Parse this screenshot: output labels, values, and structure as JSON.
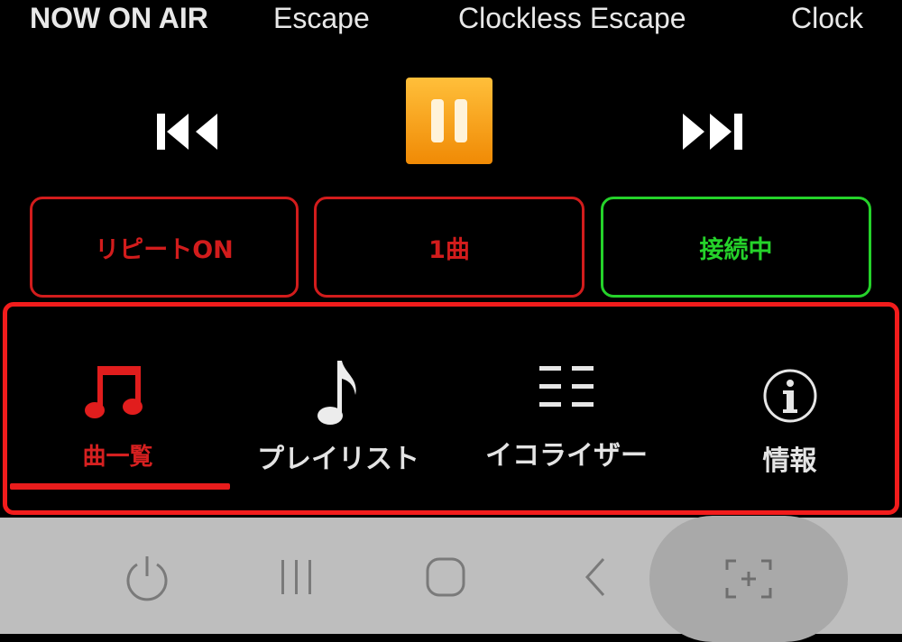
{
  "ticker": {
    "now_on_air": "NOW ON AIR",
    "items": [
      "Escape",
      "Clockless Escape",
      "Clock"
    ]
  },
  "player": {
    "prev_icon": "skip-previous-icon",
    "pause_icon": "pause-icon",
    "next_icon": "skip-next-icon",
    "pause_color": "#f5a01a"
  },
  "status": {
    "repeat": "リピートON",
    "count": "1曲",
    "connection": "接続中",
    "repeat_color": "#d21c1c",
    "connection_color": "#25d22a"
  },
  "tabs": [
    {
      "label": "曲一覧",
      "icon": "music-notes-icon",
      "selected": true
    },
    {
      "label": "プレイリスト",
      "icon": "music-note-icon",
      "selected": false
    },
    {
      "label": "イコライザー",
      "icon": "equalizer-icon",
      "selected": false
    },
    {
      "label": "情報",
      "icon": "info-icon",
      "selected": false
    }
  ],
  "navbar": {
    "icons": [
      "power-icon",
      "recent-apps-icon",
      "home-icon",
      "back-icon",
      "screen-capture-icon"
    ]
  }
}
